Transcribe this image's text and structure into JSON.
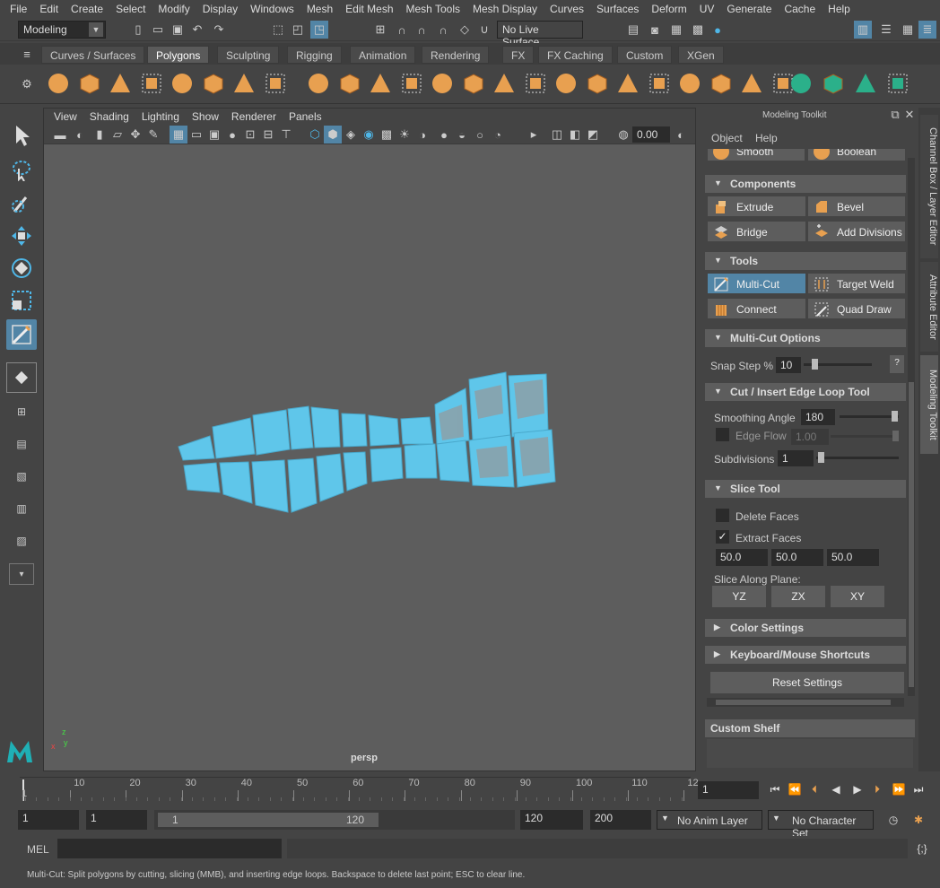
{
  "menubar": [
    "File",
    "Edit",
    "Create",
    "Select",
    "Modify",
    "Display",
    "Windows",
    "Mesh",
    "Edit Mesh",
    "Mesh Tools",
    "Mesh Display",
    "Curves",
    "Surfaces",
    "Deform",
    "UV",
    "Generate",
    "Cache",
    "Help"
  ],
  "status": {
    "mode": "Modeling",
    "live_surface": "No Live Surface"
  },
  "shelf_tabs": [
    "Curves / Surfaces",
    "Polygons",
    "Sculpting",
    "Rigging",
    "Animation",
    "Rendering",
    "FX",
    "FX Caching",
    "Custom",
    "XGen"
  ],
  "shelf_active": "Polygons",
  "viewport": {
    "menu": [
      "View",
      "Shading",
      "Lighting",
      "Show",
      "Renderer",
      "Panels"
    ],
    "exposure": "0.00",
    "camera": "persp",
    "axis": {
      "x": "x",
      "y": "y",
      "z": "z"
    }
  },
  "panel": {
    "title": "Modeling Toolkit",
    "menu": [
      "Object",
      "Help"
    ],
    "partial_row": [
      "Smooth",
      "Boolean"
    ],
    "components_header": "Components",
    "components": [
      "Extrude",
      "Bevel",
      "Bridge",
      "Add Divisions"
    ],
    "tools_header": "Tools",
    "tools": [
      "Multi-Cut",
      "Target Weld",
      "Connect",
      "Quad Draw"
    ],
    "multicut_header": "Multi-Cut Options",
    "snap_label": "Snap Step %",
    "snap_value": "10",
    "snap_help": "?",
    "cut_header": "Cut / Insert Edge Loop Tool",
    "smoothing_label": "Smoothing Angle",
    "smoothing_value": "180",
    "edgeflow_label": "Edge Flow",
    "edgeflow_value": "1.00",
    "subdiv_label": "Subdivisions",
    "subdiv_value": "1",
    "slice_header": "Slice Tool",
    "delete_faces": "Delete Faces",
    "extract_faces": "Extract Faces",
    "extract_check": "✓",
    "extract_values": [
      "50.0",
      "50.0",
      "50.0"
    ],
    "slice_plane_label": "Slice Along Plane:",
    "planes": [
      "YZ",
      "ZX",
      "XY"
    ],
    "color_header": "Color Settings",
    "keyboard_header": "Keyboard/Mouse Shortcuts",
    "reset": "Reset Settings",
    "custom_shelf": "Custom Shelf"
  },
  "side_tabs": [
    "Channel Box / Layer Editor",
    "Attribute Editor",
    "Modeling Toolkit"
  ],
  "timeline": {
    "ticks": [
      "1",
      "10",
      "20",
      "30",
      "40",
      "50",
      "60",
      "70",
      "80",
      "90",
      "100",
      "110",
      "12"
    ],
    "current_frame": "1"
  },
  "range": {
    "start": "1",
    "playback_start": "1",
    "slider_start": "1",
    "slider_end": "120",
    "playback_end": "120",
    "end": "200",
    "anim_layer": "No Anim Layer",
    "char_set": "No Character Set"
  },
  "cmd": {
    "label": "MEL"
  },
  "help_line": "Multi-Cut: Split polygons by cutting, slicing (MMB), and inserting edge loops. Backspace to delete last point; ESC to clear line.",
  "colors": {
    "accent": "#5285a6",
    "mesh": "#5fc6ea",
    "orange": "#e8a050"
  }
}
